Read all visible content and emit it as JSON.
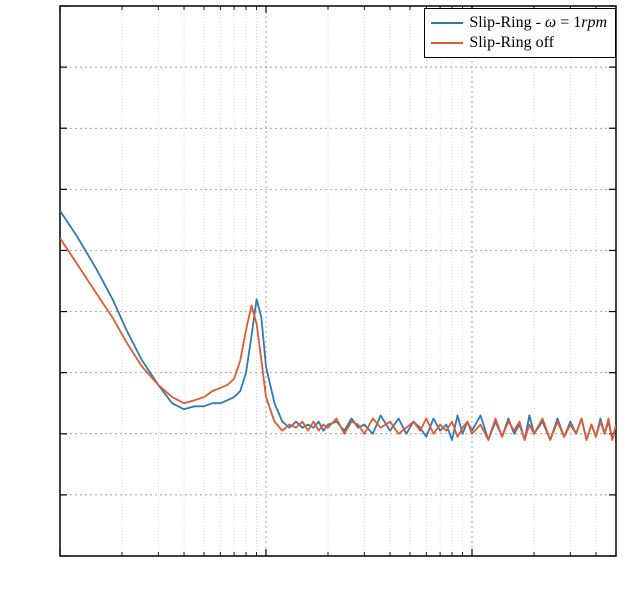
{
  "chart_data": {
    "type": "line",
    "title": "",
    "xlabel": "",
    "ylabel": "",
    "x_scale": "log",
    "x_ticks_major": [
      1,
      10,
      100
    ],
    "x_ticks_minor": [
      2,
      3,
      4,
      5,
      6,
      7,
      8,
      9,
      20,
      30,
      40,
      50,
      60,
      70,
      80,
      90,
      200,
      300,
      400,
      500
    ],
    "xlim": [
      1,
      500
    ],
    "y_ticks_major": [
      -10,
      -9,
      -8,
      -7,
      -6,
      -5,
      -4,
      -3,
      -2,
      -1
    ],
    "ylim": [
      -10,
      -1
    ],
    "grid": true,
    "legend_position": "top-right",
    "series": [
      {
        "name": "Slip-Ring - ω = 1rpm",
        "legend_label": "Slip-Ring - ω = 1rpm",
        "color": "#2c7bb6",
        "x": [
          1.0,
          1.2,
          1.5,
          1.8,
          2.1,
          2.5,
          3.0,
          3.5,
          4.0,
          4.5,
          5.0,
          5.5,
          6.0,
          6.5,
          7.0,
          7.5,
          8.0,
          8.5,
          9.0,
          9.5,
          10,
          11,
          12,
          13,
          14,
          15,
          16,
          17,
          18,
          19,
          20,
          22,
          24,
          26,
          28,
          30,
          33,
          36,
          40,
          44,
          48,
          52,
          56,
          60,
          65,
          70,
          75,
          80,
          85,
          90,
          95,
          100,
          110,
          120,
          130,
          140,
          150,
          160,
          170,
          180,
          190,
          200,
          220,
          240,
          260,
          280,
          300,
          320,
          340,
          360,
          380,
          400,
          420,
          440,
          460,
          480,
          500
        ],
        "y": [
          -4.35,
          -4.75,
          -5.3,
          -5.8,
          -6.3,
          -6.8,
          -7.2,
          -7.5,
          -7.6,
          -7.55,
          -7.55,
          -7.5,
          -7.5,
          -7.45,
          -7.4,
          -7.3,
          -7.0,
          -6.4,
          -5.8,
          -6.1,
          -6.9,
          -7.5,
          -7.8,
          -7.9,
          -7.8,
          -7.9,
          -7.85,
          -7.9,
          -7.8,
          -7.95,
          -7.85,
          -7.8,
          -7.95,
          -7.75,
          -7.9,
          -7.85,
          -8.0,
          -7.7,
          -7.95,
          -7.75,
          -8.0,
          -7.8,
          -7.9,
          -8.05,
          -7.75,
          -7.95,
          -7.85,
          -8.1,
          -7.7,
          -8.0,
          -7.8,
          -7.95,
          -7.7,
          -8.1,
          -7.8,
          -8.05,
          -7.75,
          -8.0,
          -7.85,
          -8.1,
          -7.7,
          -8.0,
          -7.8,
          -8.1,
          -7.75,
          -8.05,
          -7.8,
          -8.0,
          -7.75,
          -8.1,
          -7.85,
          -8.05,
          -7.75,
          -8.0,
          -7.8,
          -8.1,
          -7.85
        ]
      },
      {
        "name": "Slip-Ring off",
        "legend_label": "Slip-Ring off",
        "color": "#e15a30",
        "x": [
          1.0,
          1.2,
          1.5,
          1.8,
          2.1,
          2.5,
          3.0,
          3.5,
          4.0,
          4.5,
          5.0,
          5.5,
          6.0,
          6.5,
          7.0,
          7.5,
          8.0,
          8.5,
          9.0,
          9.5,
          10,
          11,
          12,
          13,
          14,
          15,
          16,
          17,
          18,
          19,
          20,
          22,
          24,
          26,
          28,
          30,
          33,
          36,
          40,
          44,
          48,
          52,
          56,
          60,
          65,
          70,
          75,
          80,
          85,
          90,
          95,
          100,
          110,
          120,
          130,
          140,
          150,
          160,
          170,
          180,
          190,
          200,
          220,
          240,
          260,
          280,
          300,
          320,
          340,
          360,
          380,
          400,
          420,
          440,
          460,
          480,
          500
        ],
        "y": [
          -4.8,
          -5.2,
          -5.7,
          -6.1,
          -6.5,
          -6.9,
          -7.2,
          -7.4,
          -7.5,
          -7.45,
          -7.4,
          -7.3,
          -7.25,
          -7.2,
          -7.1,
          -6.8,
          -6.3,
          -5.9,
          -6.2,
          -6.8,
          -7.4,
          -7.8,
          -7.95,
          -7.85,
          -7.9,
          -7.8,
          -7.95,
          -7.8,
          -7.95,
          -7.85,
          -7.9,
          -7.75,
          -8.0,
          -7.8,
          -7.85,
          -8.0,
          -7.75,
          -7.9,
          -7.8,
          -8.0,
          -7.9,
          -7.8,
          -7.95,
          -7.75,
          -8.0,
          -7.85,
          -7.95,
          -7.8,
          -8.05,
          -7.9,
          -7.8,
          -8.0,
          -7.85,
          -8.1,
          -7.75,
          -8.05,
          -7.8,
          -7.95,
          -7.8,
          -8.1,
          -7.85,
          -8.0,
          -7.75,
          -8.1,
          -7.8,
          -8.05,
          -7.85,
          -8.0,
          -7.75,
          -8.1,
          -7.85,
          -8.05,
          -7.8,
          -8.0,
          -7.75,
          -8.1,
          -7.85
        ]
      }
    ]
  },
  "legend": {
    "series1_html": "Slip-Ring - <i>ω</i> = 1<i>rpm</i>",
    "series2_html": "Slip-Ring off"
  }
}
